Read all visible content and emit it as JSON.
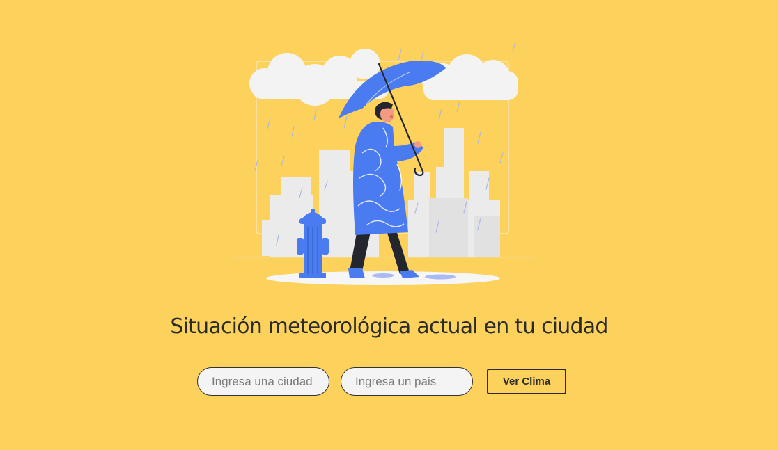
{
  "hero": {
    "illustration": "person-walking-with-umbrella-in-rain"
  },
  "heading": "Situación meteorológica actual en tu ciudad",
  "form": {
    "city_placeholder": "Ingresa una ciudad",
    "country_placeholder": "Ingresa un pais",
    "submit_label": "Ver Clima"
  },
  "colors": {
    "background": "#fcd15c",
    "accent_blue": "#4a7bf0",
    "text": "#2b2b2b"
  }
}
